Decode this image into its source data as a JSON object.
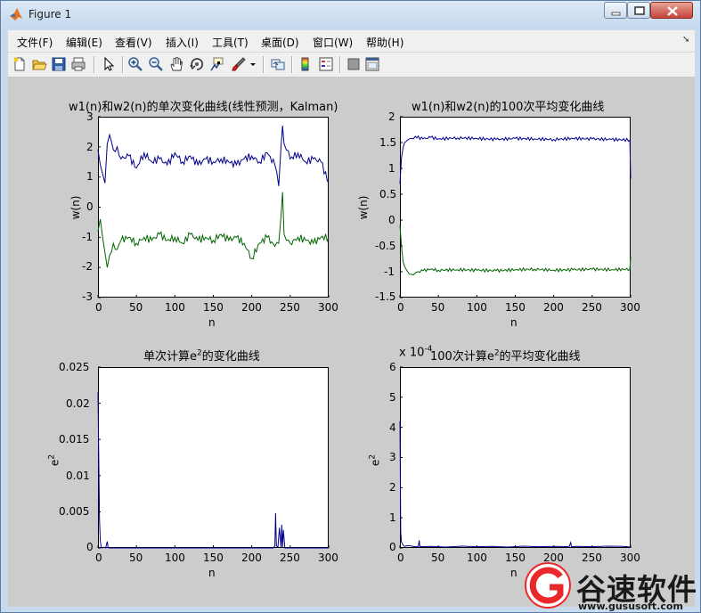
{
  "window": {
    "title": "Figure 1",
    "caption_buttons": [
      "minimize",
      "maximize",
      "close"
    ]
  },
  "menubar": {
    "items": [
      "文件(F)",
      "编辑(E)",
      "查看(V)",
      "插入(I)",
      "工具(T)",
      "桌面(D)",
      "窗口(W)",
      "帮助(H)"
    ],
    "overflow_icon": "dock-arrow-icon"
  },
  "toolbar": {
    "buttons": [
      "new-figure-icon",
      "open-file-icon",
      "save-icon",
      "print-icon",
      "select-arrow-icon",
      "zoom-in-icon",
      "zoom-out-icon",
      "pan-hand-icon",
      "rotate-3d-icon",
      "data-cursor-icon",
      "brush-icon",
      "link-plot-icon",
      "colorbar-icon",
      "legend-icon",
      "hide-plot-tools-icon",
      "show-plot-tools-icon"
    ]
  },
  "axes": [
    {
      "id": "ax1",
      "title": "w1(n)和w2(n)的单次变化曲线(线性预测，Kalman)",
      "xlabel": "n",
      "ylabel": "w(n)",
      "xticks": [
        "0",
        "50",
        "100",
        "150",
        "200",
        "250",
        "300"
      ],
      "yticks": [
        "3",
        "2",
        "1",
        "0",
        "-1",
        "-2",
        "-3"
      ]
    },
    {
      "id": "ax2",
      "title": "w1(n)和w2(n)的100次平均变化曲线",
      "xlabel": "n",
      "ylabel": "w(n)",
      "xticks": [
        "0",
        "50",
        "100",
        "150",
        "200",
        "250",
        "300"
      ],
      "yticks": [
        "2",
        "1.5",
        "1",
        "0.5",
        "0",
        "-0.5",
        "-1",
        "-1.5"
      ]
    },
    {
      "id": "ax3",
      "title_prefix": "单次计算e",
      "title_sup": "2",
      "title_suffix": "的变化曲线",
      "xlabel": "n",
      "ylabel_base": "e",
      "ylabel_sup": "2",
      "xticks": [
        "0",
        "50",
        "100",
        "150",
        "200",
        "250",
        "300"
      ],
      "yticks": [
        "0.025",
        "0.02",
        "0.015",
        "0.01",
        "0.005",
        "0"
      ]
    },
    {
      "id": "ax4",
      "title_prefix": "100次计算e",
      "title_sup": "2",
      "title_suffix": "的平均变化曲线",
      "exponent_base": "x 10",
      "exponent_sup": "-4",
      "xlabel": "n",
      "ylabel_base": "e",
      "ylabel_sup": "2",
      "xticks": [
        "0",
        "50",
        "100",
        "150",
        "200",
        "250",
        "300"
      ],
      "yticks": [
        "6",
        "5",
        "4",
        "3",
        "2",
        "1",
        "0"
      ]
    }
  ],
  "chart_data": [
    {
      "type": "line",
      "title": "w1(n)和w2(n)的单次变化曲线(线性预测，Kalman)",
      "xlabel": "n",
      "ylabel": "w(n)",
      "xlim": [
        0,
        300
      ],
      "ylim": [
        -3,
        3
      ],
      "series": [
        {
          "color": "#00008b",
          "x": [
            0,
            3,
            6,
            9,
            12,
            15,
            20,
            25,
            30,
            40,
            50,
            60,
            70,
            80,
            90,
            100,
            110,
            120,
            130,
            140,
            150,
            160,
            170,
            180,
            190,
            200,
            210,
            220,
            230,
            235,
            238,
            240,
            242,
            245,
            250,
            260,
            270,
            280,
            290,
            300
          ],
          "y": [
            1.9,
            1.4,
            1.1,
            0.8,
            2.1,
            2.4,
            1.9,
            2.0,
            1.6,
            1.7,
            1.3,
            1.8,
            1.5,
            1.6,
            1.4,
            1.8,
            1.5,
            1.7,
            1.4,
            1.6,
            1.5,
            1.6,
            1.5,
            1.4,
            1.6,
            1.7,
            1.5,
            1.8,
            1.4,
            0.7,
            2.0,
            2.7,
            2.1,
            1.9,
            1.6,
            1.8,
            1.5,
            1.6,
            1.5,
            0.8
          ]
        },
        {
          "color": "#006400",
          "x": [
            0,
            3,
            6,
            9,
            12,
            15,
            20,
            25,
            30,
            40,
            50,
            60,
            70,
            80,
            90,
            100,
            110,
            120,
            130,
            140,
            150,
            160,
            170,
            180,
            190,
            200,
            210,
            220,
            230,
            235,
            238,
            240,
            242,
            245,
            250,
            260,
            270,
            280,
            290,
            300
          ],
          "y": [
            -0.8,
            -0.4,
            -1.0,
            -1.5,
            -2.0,
            -1.6,
            -1.2,
            -1.4,
            -1.1,
            -1.0,
            -1.2,
            -1.0,
            -1.1,
            -0.9,
            -1.1,
            -1.0,
            -1.2,
            -0.9,
            -1.1,
            -1.0,
            -1.1,
            -0.9,
            -1.1,
            -1.0,
            -1.2,
            -1.7,
            -1.2,
            -1.0,
            -1.3,
            -1.2,
            -0.3,
            0.5,
            -0.9,
            -1.1,
            -1.2,
            -1.0,
            -1.1,
            -1.2,
            -1.0,
            -1.0
          ]
        }
      ]
    },
    {
      "type": "line",
      "title": "w1(n)和w2(n)的100次平均变化曲线",
      "xlabel": "n",
      "ylabel": "w(n)",
      "xlim": [
        0,
        300
      ],
      "ylim": [
        -1.5,
        2
      ],
      "series": [
        {
          "color": "#00008b",
          "x": [
            0,
            2,
            4,
            6,
            8,
            10,
            15,
            20,
            30,
            40,
            50,
            75,
            100,
            125,
            150,
            175,
            200,
            225,
            250,
            275,
            299,
            300
          ],
          "y": [
            0.7,
            1.2,
            1.4,
            1.5,
            1.52,
            1.55,
            1.58,
            1.62,
            1.57,
            1.6,
            1.57,
            1.59,
            1.58,
            1.56,
            1.58,
            1.57,
            1.56,
            1.58,
            1.57,
            1.56,
            1.55,
            0.8
          ]
        },
        {
          "color": "#006400",
          "x": [
            0,
            2,
            4,
            6,
            8,
            10,
            15,
            20,
            30,
            40,
            50,
            75,
            100,
            125,
            150,
            175,
            200,
            225,
            250,
            275,
            299,
            300
          ],
          "y": [
            -0.1,
            -0.5,
            -0.8,
            -0.9,
            -0.95,
            -1.0,
            -1.05,
            -1.02,
            -0.98,
            -0.95,
            -0.97,
            -0.96,
            -0.97,
            -0.98,
            -0.96,
            -0.95,
            -0.97,
            -0.96,
            -0.95,
            -0.96,
            -0.95,
            -0.7
          ]
        }
      ]
    },
    {
      "type": "line",
      "title": "单次计算e2的变化曲线",
      "xlabel": "n",
      "ylabel": "e2",
      "xlim": [
        0,
        300
      ],
      "ylim": [
        0,
        0.025
      ],
      "series": [
        {
          "color": "#00008b",
          "x": [
            0,
            1,
            2,
            3,
            4,
            5,
            8,
            10,
            12,
            13,
            14,
            16,
            20,
            50,
            100,
            150,
            200,
            228,
            230,
            231,
            232,
            234,
            236,
            238,
            239,
            240,
            241,
            243,
            250,
            300
          ],
          "y": [
            0.0215,
            0.012,
            0.004,
            0.001,
            0.0002,
            0,
            0.0001,
            0,
            0.0009,
            0.0002,
            0,
            0,
            0,
            0,
            0,
            0,
            0,
            0,
            0.0003,
            0.0048,
            0.0003,
            0.0001,
            0.0028,
            0.0001,
            0.0032,
            0.0001,
            0.0025,
            0,
            0,
            0
          ]
        }
      ]
    },
    {
      "type": "line",
      "title": "100次计算e2的平均变化曲线",
      "xlabel": "n",
      "ylabel": "e2",
      "xlim": [
        0,
        300
      ],
      "ylim": [
        0,
        0.0006
      ],
      "series": [
        {
          "color": "#00008b",
          "x": [
            0,
            1,
            2,
            3,
            4,
            6,
            10,
            20,
            24,
            25,
            26,
            40,
            60,
            80,
            100,
            120,
            140,
            160,
            180,
            200,
            220,
            222,
            223,
            230,
            250,
            270,
            290,
            300
          ],
          "y": [
            0.00042,
            5e-05,
            2e-05,
            1.5e-05,
            1e-05,
            5e-06,
            8e-06,
            4e-06,
            5e-06,
            2.5e-05,
            4e-06,
            5e-06,
            3e-06,
            6e-06,
            4e-06,
            5e-06,
            3e-06,
            6e-06,
            4e-06,
            5e-06,
            4e-06,
            1.8e-05,
            4e-06,
            5e-06,
            4e-06,
            6e-06,
            5e-06,
            3e-06
          ]
        }
      ]
    }
  ],
  "watermark": {
    "brand": "谷速软件",
    "url": "www.gususoft.com",
    "accent": "#e8282b"
  }
}
